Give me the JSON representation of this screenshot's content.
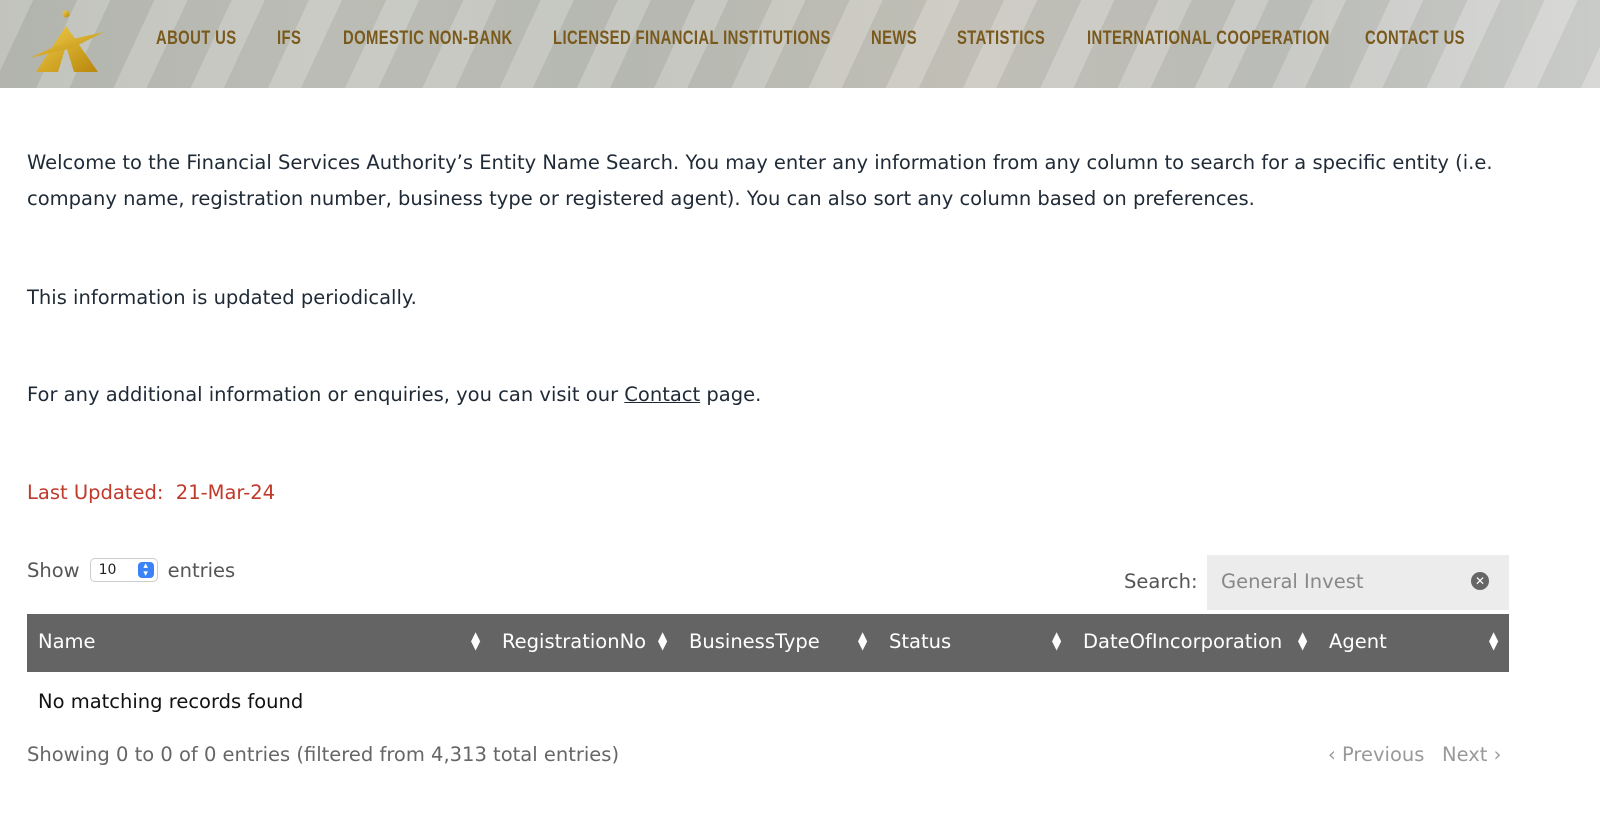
{
  "nav": {
    "items": [
      "ABOUT US",
      "IFS",
      "DOMESTIC NON-BANK",
      "LICENSED FINANCIAL INSTITUTIONS",
      "NEWS",
      "STATISTICS",
      "INTERNATIONAL COOPERATION",
      "CONTACT US"
    ],
    "color": "#7a5a1c"
  },
  "intro": {
    "welcome": "Welcome to the Financial Services Authority’s Entity Name Search. You may enter any information from any column to search for a specific entity (i.e. company name, registration number, business type or registered agent). You can also sort any column based on preferences.",
    "periodic": "This information is updated periodically.",
    "contact_pre": "For any additional information or enquiries, you can visit our ",
    "contact_link": "Contact",
    "contact_post": " page.",
    "last_updated_label": "Last Updated:",
    "last_updated_value": "21-Mar-24"
  },
  "table": {
    "show_label": "Show",
    "page_size": "10",
    "entries_label": "entries",
    "search_label": "Search:",
    "search_value": "General Invest",
    "columns": [
      "Name",
      "RegistrationNo",
      "BusinessType",
      "Status",
      "DateOfIncorporation",
      "Agent"
    ],
    "empty": "No matching records found",
    "info": "Showing 0 to 0 of 0 entries (filtered from 4,313 total entries)",
    "previous": "Previous",
    "next": "Next"
  }
}
